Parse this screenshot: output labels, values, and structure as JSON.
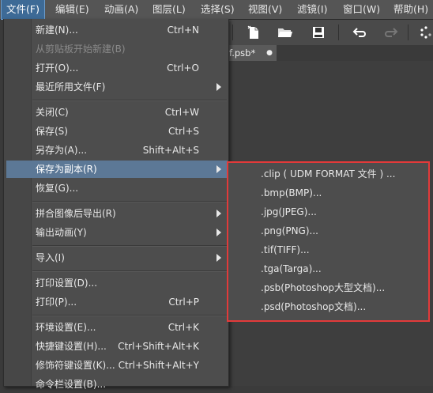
{
  "menubar": [
    {
      "label": "文件(F)",
      "active": true
    },
    {
      "label": "编辑(E)"
    },
    {
      "label": "动画(A)"
    },
    {
      "label": "图层(L)"
    },
    {
      "label": "选择(S)"
    },
    {
      "label": "视图(V)"
    },
    {
      "label": "滤镜(I)"
    },
    {
      "label": "窗口(W)"
    },
    {
      "label": "帮助(H)"
    }
  ],
  "toolbar": {
    "icons": [
      "new-page-icon",
      "open-folder-icon",
      "save-icon",
      "undo-icon",
      "redo-icon",
      "loading-icon"
    ]
  },
  "tab": {
    "title": "f.psb*",
    "dot": "●"
  },
  "file_menu": {
    "items": [
      {
        "label": "新建(N)...",
        "shortcut": "Ctrl+N"
      },
      {
        "label": "从剪贴板开始新建(B)",
        "disabled": true
      },
      {
        "label": "打开(O)...",
        "shortcut": "Ctrl+O"
      },
      {
        "label": "最近所用文件(F)",
        "submenu": true
      },
      {
        "label": "关闭(C)",
        "shortcut": "Ctrl+W"
      },
      {
        "label": "保存(S)",
        "shortcut": "Ctrl+S"
      },
      {
        "label": "另存为(A)...",
        "shortcut": "Shift+Alt+S"
      },
      {
        "label": "保存为副本(R)",
        "submenu": true,
        "highlighted": true
      },
      {
        "label": "恢复(G)..."
      },
      {
        "label": "拼合图像后导出(R)",
        "submenu": true
      },
      {
        "label": "输出动画(Y)",
        "submenu": true
      },
      {
        "label": "导入(I)",
        "submenu": true
      },
      {
        "label": "打印设置(D)..."
      },
      {
        "label": "打印(P)...",
        "shortcut": "Ctrl+P"
      },
      {
        "label": "环境设置(E)...",
        "shortcut": "Ctrl+K"
      },
      {
        "label": "快捷键设置(H)...",
        "shortcut": "Ctrl+Shift+Alt+K"
      },
      {
        "label": "修饰符键设置(K)...",
        "shortcut": "Ctrl+Shift+Alt+Y"
      },
      {
        "label": "命令栏设置(B)..."
      }
    ]
  },
  "save_copy_submenu": {
    "items": [
      {
        "label": ".clip ( UDM  FORMAT 文件 ) ..."
      },
      {
        "label": ".bmp(BMP)..."
      },
      {
        "label": ".jpg(JPEG)..."
      },
      {
        "label": ".png(PNG)..."
      },
      {
        "label": ".tif(TIFF)..."
      },
      {
        "label": ".tga(Targa)..."
      },
      {
        "label": ".psb(Photoshop大型文档)..."
      },
      {
        "label": ".psd(Photoshop文档)..."
      }
    ],
    "highlight_color": "#e23a3a"
  }
}
